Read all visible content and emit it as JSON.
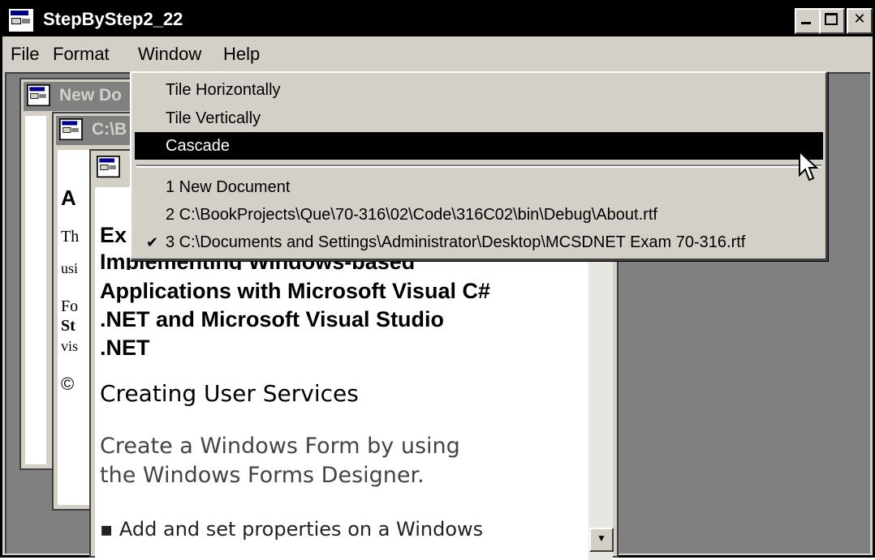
{
  "window": {
    "title": "StepByStep2_22"
  },
  "menubar": {
    "items": [
      "File",
      "Format",
      "Window",
      "Help"
    ]
  },
  "children": {
    "back_title": "New Do",
    "middle_title": "C:\\B",
    "middle_text": [
      "A",
      "Th",
      "usi",
      "Fo",
      "St",
      "vis",
      "©"
    ]
  },
  "front_doc": {
    "heading_part": "Ex",
    "heading_lines": [
      "Implementing Windows-based",
      "Applications with Microsoft Visual C#",
      ".NET and Microsoft Visual Studio",
      ".NET"
    ],
    "section": "Creating User Services",
    "body_lines": [
      "Create a Windows Form by using",
      "the Windows Forms Designer."
    ],
    "bullet": "Add and set properties on a Windows"
  },
  "window_menu": {
    "items": [
      {
        "label": "Tile Horizontally"
      },
      {
        "label": "Tile Vertically"
      },
      {
        "label": "Cascade",
        "selected": true
      }
    ],
    "documents": [
      {
        "label": "1 New Document"
      },
      {
        "label": "2 C:\\BookProjects\\Que\\70-316\\02\\Code\\316C02\\bin\\Debug\\About.rtf"
      },
      {
        "label": "3 C:\\Documents and Settings\\Administrator\\Desktop\\MCSDNET Exam 70-316.rtf",
        "checked": true
      }
    ]
  },
  "colors": {
    "titlebar": "#000000",
    "face": "#d4d0c8",
    "mdi_background": "#808080",
    "selection": "#000000"
  }
}
